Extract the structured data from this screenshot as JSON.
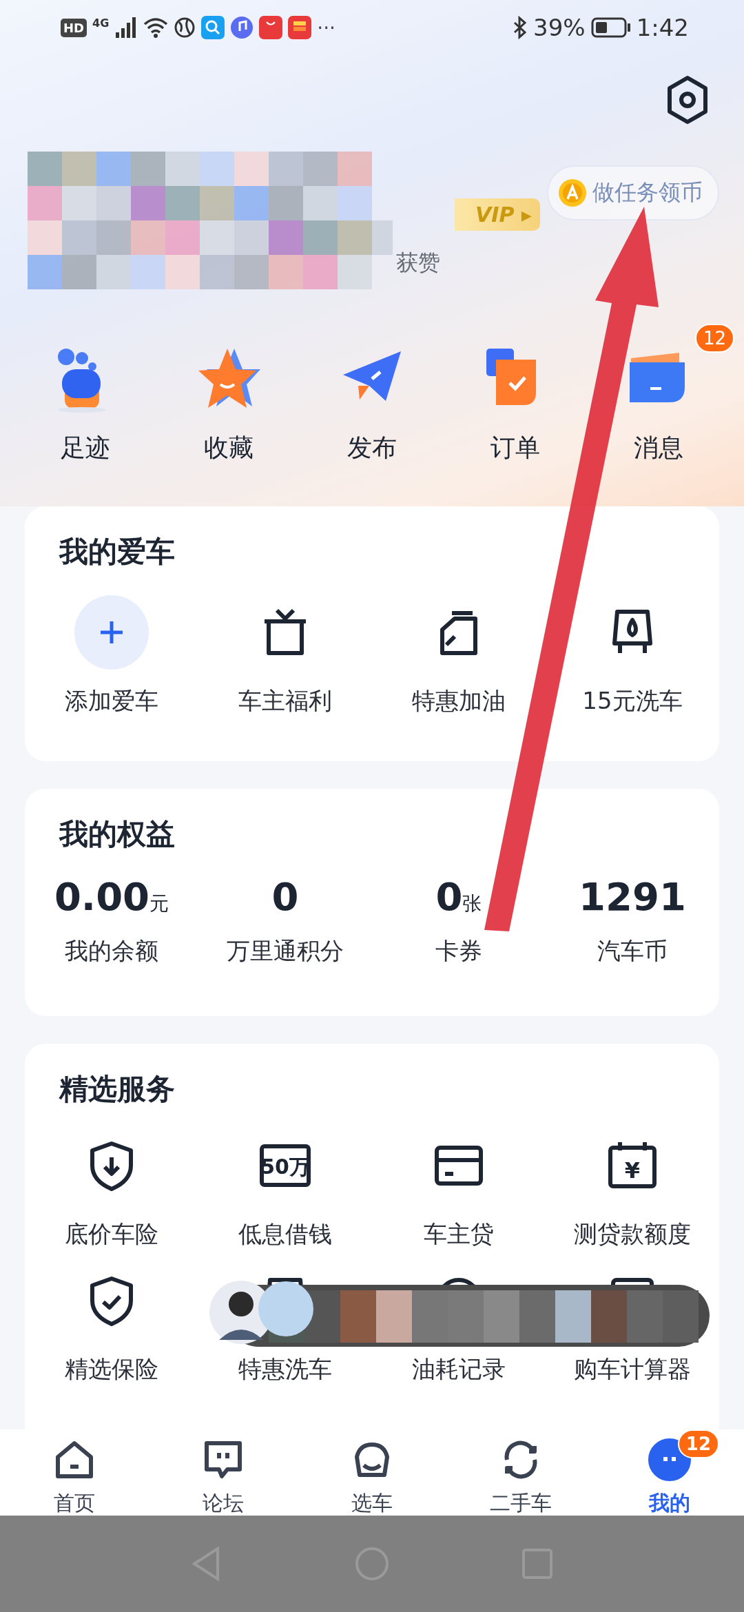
{
  "status_bar": {
    "hd": "HD",
    "network": "4G",
    "more": "···",
    "battery": "39%",
    "time": "1:42"
  },
  "profile": {
    "vip": "VIP ▸",
    "likes_label": "获赞"
  },
  "task_button": {
    "label": "做任务领币"
  },
  "shortcuts": [
    {
      "kind": "footprint",
      "label": "足迹"
    },
    {
      "kind": "star",
      "label": "收藏"
    },
    {
      "kind": "plane",
      "label": "发布"
    },
    {
      "kind": "order",
      "label": "订单"
    },
    {
      "kind": "message",
      "label": "消息",
      "badge": "12"
    }
  ],
  "my_car": {
    "title": "我的爱车",
    "items": [
      {
        "kind": "add",
        "label": "添加爱车"
      },
      {
        "kind": "gift",
        "label": "车主福利"
      },
      {
        "kind": "fuel",
        "label": "特惠加油"
      },
      {
        "kind": "wash",
        "label": "15元洗车"
      }
    ]
  },
  "benefits": {
    "title": "我的权益",
    "items": [
      {
        "value": "0.00",
        "unit": "元",
        "label": "我的余额"
      },
      {
        "value": "0",
        "label": "万里通积分"
      },
      {
        "value": "0",
        "unit": "张",
        "label": "卡券"
      },
      {
        "value": "1291",
        "label": "汽车币"
      }
    ]
  },
  "services": {
    "title": "精选服务",
    "items": [
      {
        "kind": "shield-down",
        "label": "底价车险"
      },
      {
        "kind": "amount",
        "icon_text": "50万",
        "label": "低息借钱"
      },
      {
        "kind": "card",
        "label": "车主贷"
      },
      {
        "kind": "calendar",
        "icon_text": "¥",
        "label": "测贷款额度"
      },
      {
        "kind": "shield-check",
        "label": "精选保险"
      },
      {
        "kind": "wash",
        "label": "特惠洗车"
      },
      {
        "kind": "gauge",
        "label": "油耗记录"
      },
      {
        "kind": "calc",
        "label": "购车计算器"
      }
    ]
  },
  "tabs": [
    {
      "kind": "home",
      "label": "首页",
      "selected": false
    },
    {
      "kind": "forum",
      "label": "论坛",
      "selected": false
    },
    {
      "kind": "car",
      "label": "选车",
      "selected": false
    },
    {
      "kind": "used",
      "label": "二手车",
      "selected": false
    },
    {
      "kind": "me",
      "label": "我的",
      "selected": true,
      "badge": "12"
    }
  ]
}
